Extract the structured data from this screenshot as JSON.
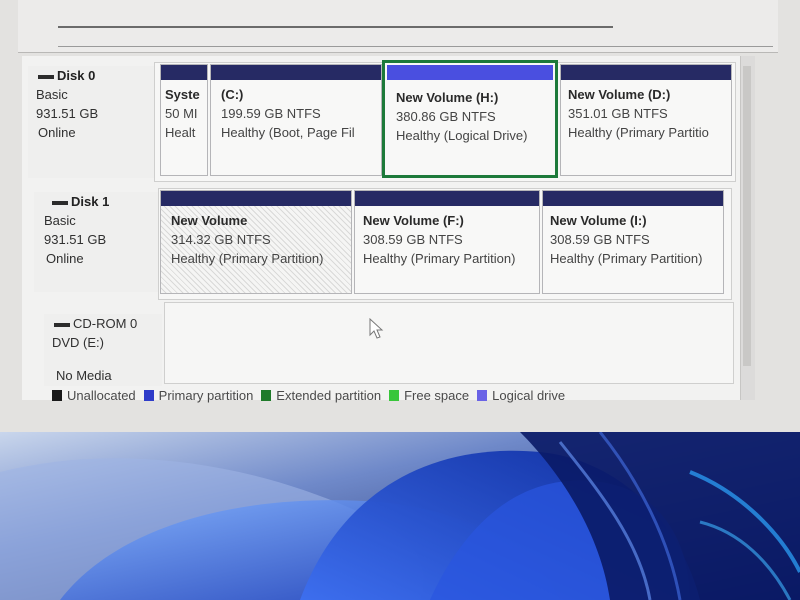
{
  "disks": [
    {
      "name": "Disk 0",
      "type": "Basic",
      "size": "931.51 GB",
      "status": "Online"
    },
    {
      "name": "Disk 1",
      "type": "Basic",
      "size": "931.51 GB",
      "status": "Online"
    },
    {
      "name": "CD-ROM 0",
      "type": "DVD (E:)",
      "status": "No Media"
    }
  ],
  "disk0_partitions": [
    {
      "title": "Syste",
      "size": "50 MI",
      "status": "Healt"
    },
    {
      "title": "(C:)",
      "size": "199.59 GB NTFS",
      "status": "Healthy (Boot, Page Fil"
    },
    {
      "title": "New Volume  (H:)",
      "size": "380.86 GB NTFS",
      "status": "Healthy (Logical Drive)"
    },
    {
      "title": "New Volume  (D:)",
      "size": "351.01 GB NTFS",
      "status": "Healthy (Primary Partitio"
    }
  ],
  "disk1_partitions": [
    {
      "title": "New Volume",
      "size": "314.32 GB NTFS",
      "status": "Healthy (Primary Partition)"
    },
    {
      "title": "New Volume  (F:)",
      "size": "308.59 GB NTFS",
      "status": "Healthy (Primary Partition)"
    },
    {
      "title": "New Volume  (I:)",
      "size": "308.59 GB NTFS",
      "status": "Healthy (Primary Partition)"
    }
  ],
  "legend": [
    {
      "label": "Unallocated",
      "color": "#1a1a1a"
    },
    {
      "label": "Primary partition",
      "color": "#2f3cc9"
    },
    {
      "label": "Extended partition",
      "color": "#1f7a2a"
    },
    {
      "label": "Free space",
      "color": "#38c63a"
    },
    {
      "label": "Logical drive",
      "color": "#6a63e6"
    }
  ],
  "colors": {
    "primary_header": "#262a64",
    "logical_header": "#4a4fe0",
    "selection_border": "#1d7a3a"
  }
}
